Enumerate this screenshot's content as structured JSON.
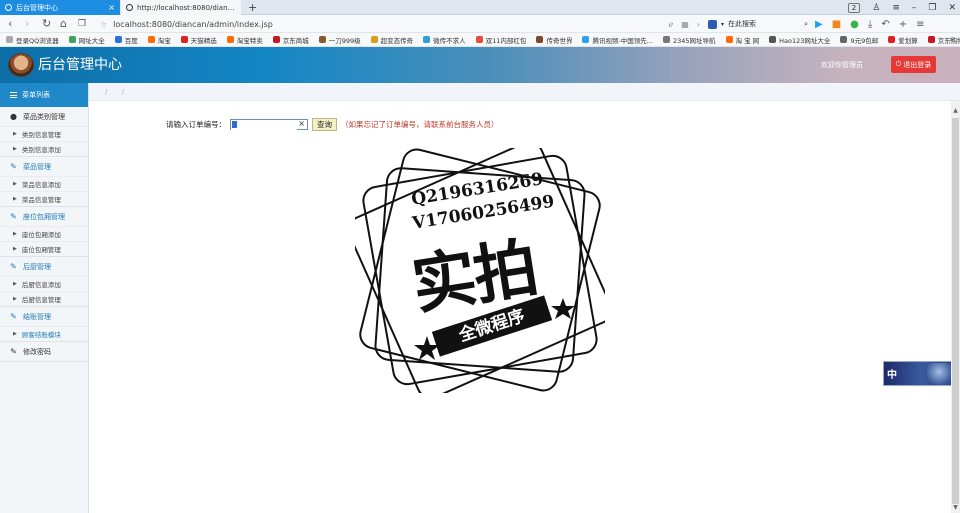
{
  "browser": {
    "tabs": [
      {
        "label": "后台管理中心",
        "active": true
      },
      {
        "label": "http://localhost:8080/diancan/go...",
        "active": false
      }
    ],
    "new_tab": "+",
    "tab_count": "2",
    "nav": {
      "back": "‹",
      "forward": "›",
      "reload": "↻",
      "home": "⌂",
      "reader": "❐"
    },
    "url": "localhost:8080/diancan/admin/index.jsp",
    "search_placeholder": "在此搜索",
    "bookmarks": [
      {
        "label": "登录QQ浏览器",
        "color": "#aaaaaa"
      },
      {
        "label": "网址大全",
        "color": "#3da35d"
      },
      {
        "label": "百度",
        "color": "#2d6fe0"
      },
      {
        "label": "淘宝",
        "color": "#ff6a00"
      },
      {
        "label": "天猫精选",
        "color": "#e02020"
      },
      {
        "label": "淘宝特卖",
        "color": "#ff6a00"
      },
      {
        "label": "京东商城",
        "color": "#c81623"
      },
      {
        "label": "一刀999级",
        "color": "#8a5a2b"
      },
      {
        "label": "超变态传奇",
        "color": "#d4a017"
      },
      {
        "label": "微传不求人",
        "color": "#2d9cdb"
      },
      {
        "label": "双11内部红包",
        "color": "#e74c3c"
      },
      {
        "label": "传奇世界",
        "color": "#7a4b2a"
      },
      {
        "label": "腾讯视频-中国领先...",
        "color": "#2aa3ef"
      },
      {
        "label": "2345网址导航",
        "color": "#777777"
      },
      {
        "label": "淘 宝 网",
        "color": "#ff6a00"
      },
      {
        "label": "Hao123网址大全",
        "color": "#555555"
      },
      {
        "label": "9元9包邮",
        "color": "#666666"
      },
      {
        "label": "爱划算",
        "color": "#e02020"
      },
      {
        "label": "京东购物",
        "color": "#c81623"
      }
    ],
    "bookmarks_more": "»"
  },
  "header": {
    "title": "后台管理中心",
    "welcome": "欢迎你管理员",
    "logout_label": "退出登录",
    "logout_color": "#e53935"
  },
  "sidebar": {
    "head": "菜单列表",
    "groups": [
      {
        "title": "菜品类别管理",
        "icon": "user-icon",
        "items": [
          "类别信息管理",
          "类别信息添加"
        ]
      },
      {
        "title": "菜品管理",
        "icon": "edit-icon",
        "items": [
          "菜品信息添加",
          "菜品信息管理"
        ]
      },
      {
        "title": "座位包厢管理",
        "icon": "edit-icon",
        "items": [
          "座位包厢添加",
          "座位包厢管理"
        ]
      },
      {
        "title": "后厨管理",
        "icon": "edit-icon",
        "items": [
          "后厨信息添加",
          "后厨信息管理"
        ]
      },
      {
        "title": "结账管理",
        "icon": "edit-icon",
        "items": [
          "顾客结账模块"
        ]
      },
      {
        "title": "修改密码",
        "icon": "edit-icon",
        "items": []
      }
    ]
  },
  "breadcrumb": "/ /",
  "query": {
    "label": "请输入订单编号：",
    "input_value": "",
    "clear": "×",
    "button": "查询",
    "note": "（如果忘记了订单编号，请联系前台服务人员）"
  },
  "watermark": {
    "line1": "Q2196316269",
    "line2": "V17060256499",
    "big": "实拍",
    "banner": "全微程序"
  },
  "float_widget": {
    "label": "中"
  }
}
